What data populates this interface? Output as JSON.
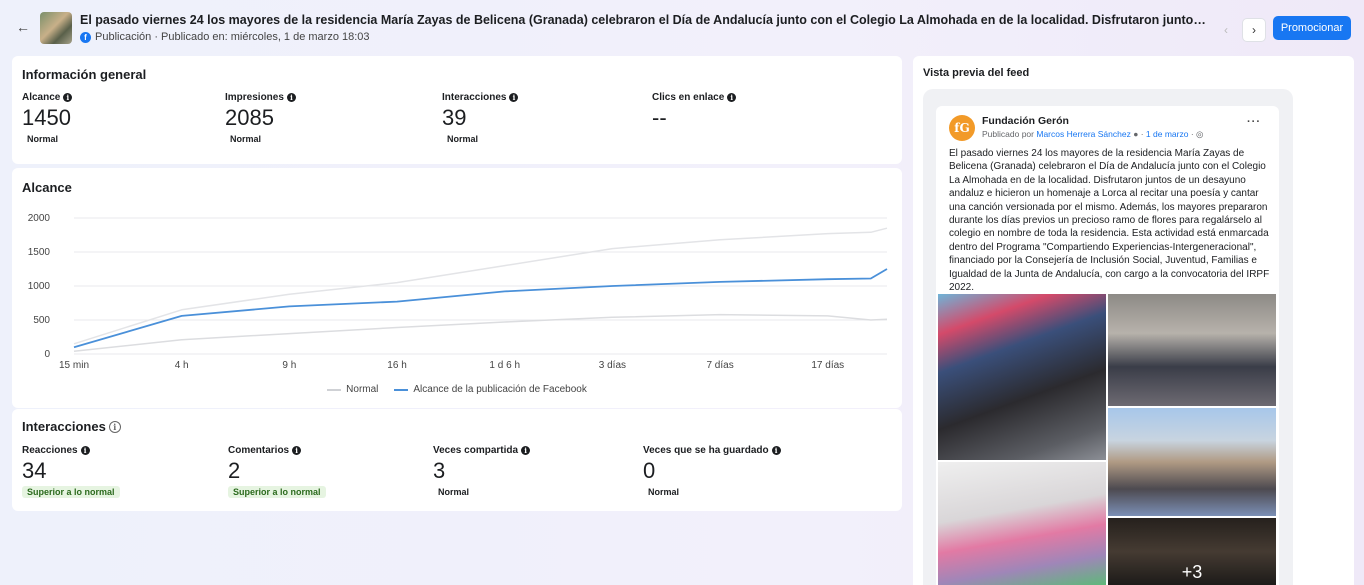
{
  "header": {
    "back_icon": "arrow-left-icon",
    "title": "El pasado viernes 24 los mayores de la residencia María Zayas de Belicena (Granada) celebraron el Día de Andalucía junto con el Colegio La Almohada en de la localidad. Disfrutaron juntos de un desayuno andaluz e hicieron ...",
    "meta": "Publicación · Publicado en: miércoles, 1 de marzo 18:03",
    "promote_label": "Promocionar",
    "prev_icon": "chevron-left-icon",
    "next_icon": "chevron-right-icon",
    "accent": "#1877f2"
  },
  "info": {
    "title": "Información general",
    "metrics": [
      {
        "label": "Alcance",
        "value": "1450",
        "badge": "Normal"
      },
      {
        "label": "Impresiones",
        "value": "2085",
        "badge": "Normal"
      },
      {
        "label": "Interacciones",
        "value": "39",
        "badge": "Normal"
      },
      {
        "label": "Clics en enlace",
        "value": "--",
        "badge": ""
      }
    ]
  },
  "reach": {
    "title": "Alcance",
    "legend": [
      "Normal",
      "Alcance de la publicación de Facebook"
    ]
  },
  "chart_data": {
    "type": "line",
    "title": "Alcance",
    "xlabel": "",
    "ylabel": "",
    "ylim": [
      0,
      2000
    ],
    "yticks": [
      "0",
      "500",
      "1000",
      "1500",
      "2000"
    ],
    "xticks": [
      "15 min",
      "4 h",
      "9 h",
      "16 h",
      "1 d 6 h",
      "3 días",
      "7 días",
      "17 días"
    ],
    "grid": true,
    "legend_position": "bottom",
    "x": [
      0,
      1,
      2,
      3,
      4,
      5,
      6,
      7,
      7.4,
      7.55
    ],
    "series": [
      {
        "name": "Normal",
        "color": "#dcdde0",
        "values": [
          40,
          210,
          300,
          390,
          470,
          540,
          580,
          560,
          500,
          510
        ]
      },
      {
        "name": "Normal",
        "color": "#e3e4e7",
        "values": [
          150,
          650,
          880,
          1050,
          1300,
          1550,
          1680,
          1770,
          1790,
          1850
        ]
      },
      {
        "name": "Alcance de la publicación de Facebook",
        "color": "#4a90d9",
        "values": [
          100,
          560,
          700,
          770,
          920,
          1000,
          1060,
          1100,
          1110,
          1250
        ]
      }
    ]
  },
  "interactions": {
    "title": "Interacciones",
    "metrics": [
      {
        "label": "Reacciones",
        "value": "34",
        "badge": "Superior a lo normal"
      },
      {
        "label": "Comentarios",
        "value": "2",
        "badge": "Superior a lo normal"
      },
      {
        "label": "Veces compartida",
        "value": "3",
        "badge": "Normal"
      },
      {
        "label": "Veces que se ha guardado",
        "value": "0",
        "badge": "Normal"
      }
    ]
  },
  "preview": {
    "title": "Vista previa del feed",
    "page_name": "Fundación Gerón",
    "published_by": "Publicado por",
    "author": "Marcos Herrera Sánchez",
    "date": "1 de marzo",
    "body": "El pasado viernes 24 los mayores de la residencia María Zayas de Belicena (Granada) celebraron el Día de Andalucía junto con el Colegio La Almohada en de la localidad. Disfrutaron juntos de un desayuno andaluz e hicieron un homenaje a Lorca al recitar una poesía y cantar una canción versionada por el mismo. Además, los mayores prepararon durante los días previos un precioso ramo de flores para regalárselo al colegio en nombre de toda la residencia. Esta actividad está enmarcada dentro del  Programa \"Compartiendo Experiencias-Intergeneracional\", financiado por la Consejería de Inclusión Social, Juventud, Familias e Igualdad de la Junta de Andalucía, con cargo a la convocatoria del IRPF 2022.",
    "more_photos": "+3",
    "avatar_letter": "fG"
  }
}
